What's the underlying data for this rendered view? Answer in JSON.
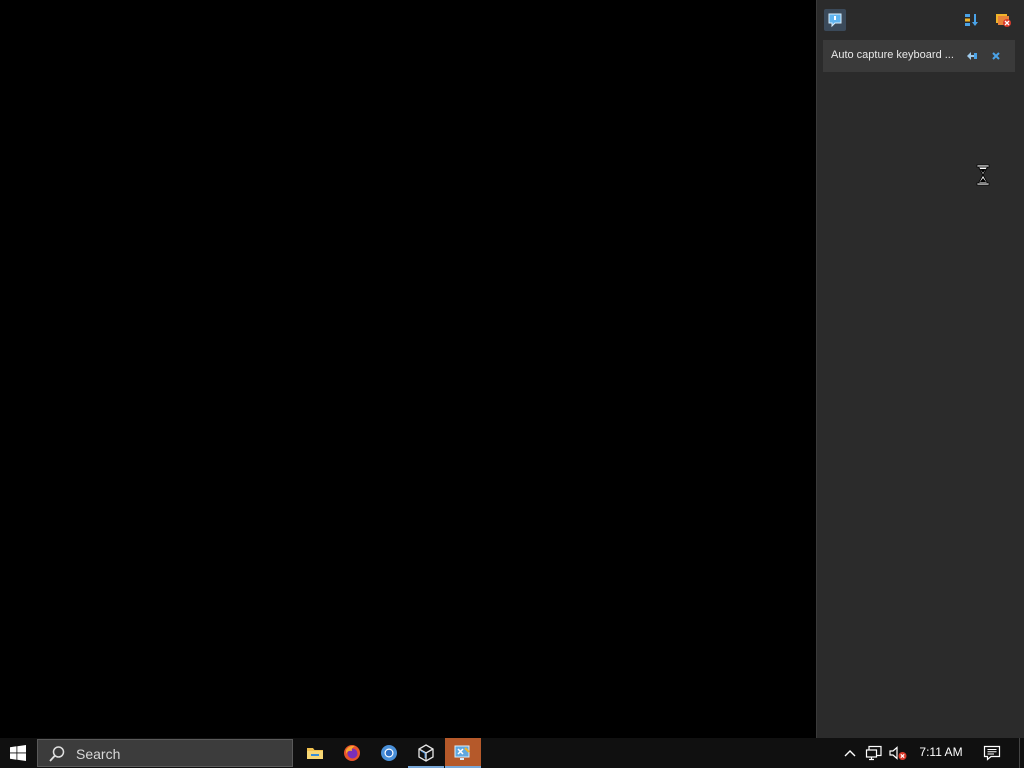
{
  "side_panel": {
    "notification": {
      "text": "Auto capture keyboard ..."
    }
  },
  "taskbar": {
    "search_placeholder": "Search",
    "clock_time": "7:11 AM",
    "pinned_apps": [
      {
        "name": "File Explorer",
        "icon": "folder-icon"
      },
      {
        "name": "Firefox",
        "icon": "firefox-icon"
      },
      {
        "name": "Chrome",
        "icon": "chrome-icon"
      },
      {
        "name": "VirtualBox",
        "icon": "virtualbox-icon"
      },
      {
        "name": "Remote session",
        "icon": "remote-session-icon"
      }
    ]
  },
  "colors": {
    "panel_bg": "#2b2b2b",
    "notification_bg": "#3a3a3a",
    "taskbar_bg": "#101010",
    "highlight_app": "#b5592a",
    "running_indicator": "#79a8d8"
  }
}
